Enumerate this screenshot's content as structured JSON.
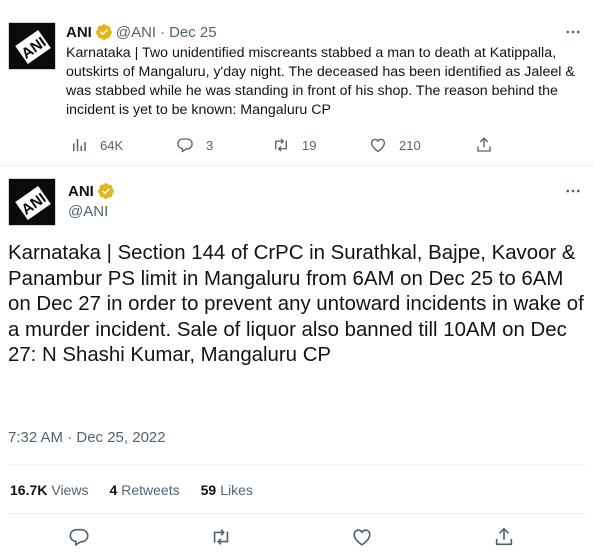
{
  "tweet1": {
    "author_name": "ANI",
    "handle": "@ANI",
    "separator": "·",
    "date": "Dec 25",
    "text": "Karnataka | Two unidentified miscreants stabbed a man to death at Katippalla, outskirts of Mangaluru, y'day night. The deceased has been identified as Jaleel & was stabbed while he was standing in front of his shop. The reason behind the incident is yet to be known: Mangaluru CP",
    "views": "64K",
    "replies": "3",
    "retweets": "19",
    "likes": "210"
  },
  "tweet2": {
    "author_name": "ANI",
    "handle": "@ANI",
    "text": "Karnataka | Section 144 of CrPC in Surathkal, Bajpe, Kavoor & Panambur PS limit in Mangaluru from 6AM on Dec 25 to 6AM on Dec 27 in order to prevent any untoward incidents in wake of a murder incident. Sale of liquor also banned till 10AM on Dec 27: N Shashi Kumar, Mangaluru CP",
    "timestamp": "7:32 AM · Dec 25, 2022",
    "views_count": "16.7K",
    "views_label": "Views",
    "retweets_count": "4",
    "retweets_label": "Retweets",
    "likes_count": "59",
    "likes_label": "Likes"
  },
  "avatar_text": "ANI",
  "colors": {
    "text": "#0f1419",
    "secondary": "#536471",
    "verified_badge": "#e2b719",
    "divider": "#eff3f4"
  },
  "icons": [
    "verified-badge-icon",
    "more-icon",
    "views-icon",
    "reply-icon",
    "retweet-icon",
    "like-icon",
    "share-icon"
  ]
}
